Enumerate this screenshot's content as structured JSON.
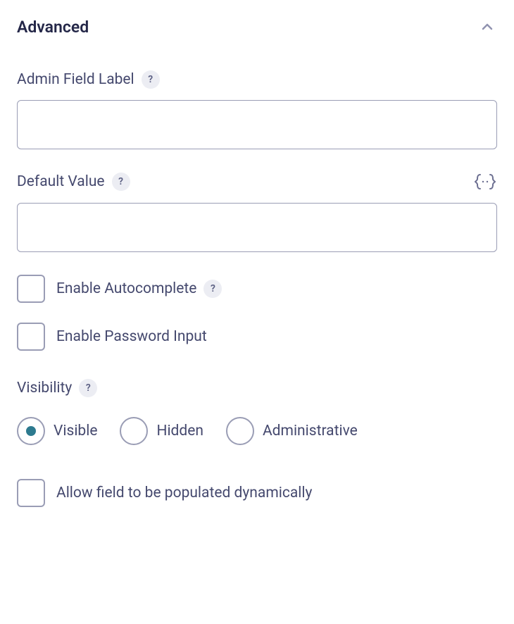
{
  "section": {
    "title": "Advanced"
  },
  "fields": {
    "adminFieldLabel": {
      "label": "Admin Field Label",
      "value": ""
    },
    "defaultValue": {
      "label": "Default Value",
      "value": ""
    },
    "enableAutocomplete": {
      "label": "Enable Autocomplete",
      "checked": false
    },
    "enablePasswordInput": {
      "label": "Enable Password Input",
      "checked": false
    },
    "visibility": {
      "label": "Visibility",
      "selected": "visible",
      "options": {
        "visible": "Visible",
        "hidden": "Hidden",
        "administrative": "Administrative"
      }
    },
    "allowDynamicPopulation": {
      "label": "Allow field to be populated dynamically",
      "checked": false
    }
  }
}
